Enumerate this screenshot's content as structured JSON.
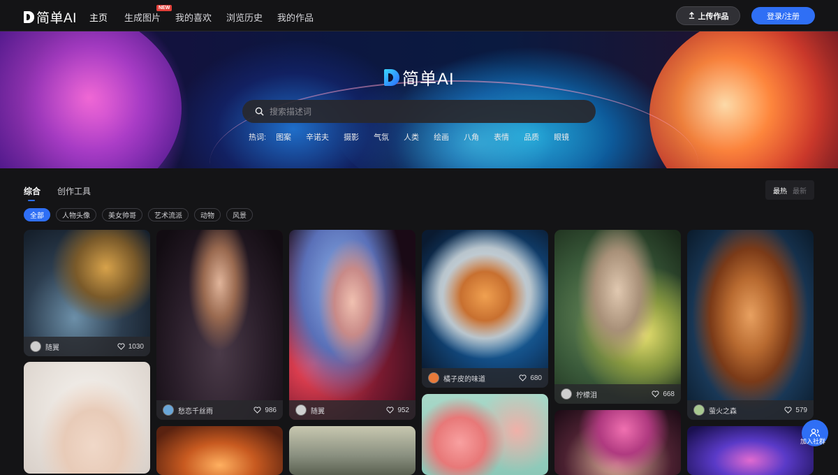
{
  "brand": {
    "name": "简单AI"
  },
  "nav": {
    "items": [
      {
        "label": "主页"
      },
      {
        "label": "生成图片",
        "badge": "NEW"
      },
      {
        "label": "我的喜欢"
      },
      {
        "label": "浏览历史"
      },
      {
        "label": "我的作品"
      }
    ],
    "upload_label": "上传作品",
    "login_label": "登录/注册"
  },
  "banner": {
    "logo_text": "简单AI",
    "search_placeholder": "搜索描述词",
    "hot_label": "热词:",
    "hot_tags": [
      "图案",
      "辛诺夫",
      "摄影",
      "气氛",
      "人类",
      "绘画",
      "八角",
      "表情",
      "品质",
      "眼镜"
    ]
  },
  "tabs": [
    "综合",
    "创作工具"
  ],
  "sort": {
    "active": "最热",
    "inactive": "最新"
  },
  "chips": [
    "全部",
    "人物头像",
    "美女帅哥",
    "艺术流派",
    "动物",
    "风景"
  ],
  "cards": [
    {
      "user": "随翼",
      "likes": "1030"
    },
    {
      "user": "愁恋千丝雨",
      "likes": "986"
    },
    {
      "user": "随翼",
      "likes": "952"
    },
    {
      "user": "橘子皮的味道",
      "likes": "680"
    },
    {
      "user": "柠檬泪",
      "likes": "668"
    },
    {
      "user": "萤火之森",
      "likes": "579"
    }
  ],
  "join_label": "加入社群",
  "colors": {
    "accent": "#2f6ff5",
    "background": "#141416",
    "badge": "#e2403a"
  }
}
